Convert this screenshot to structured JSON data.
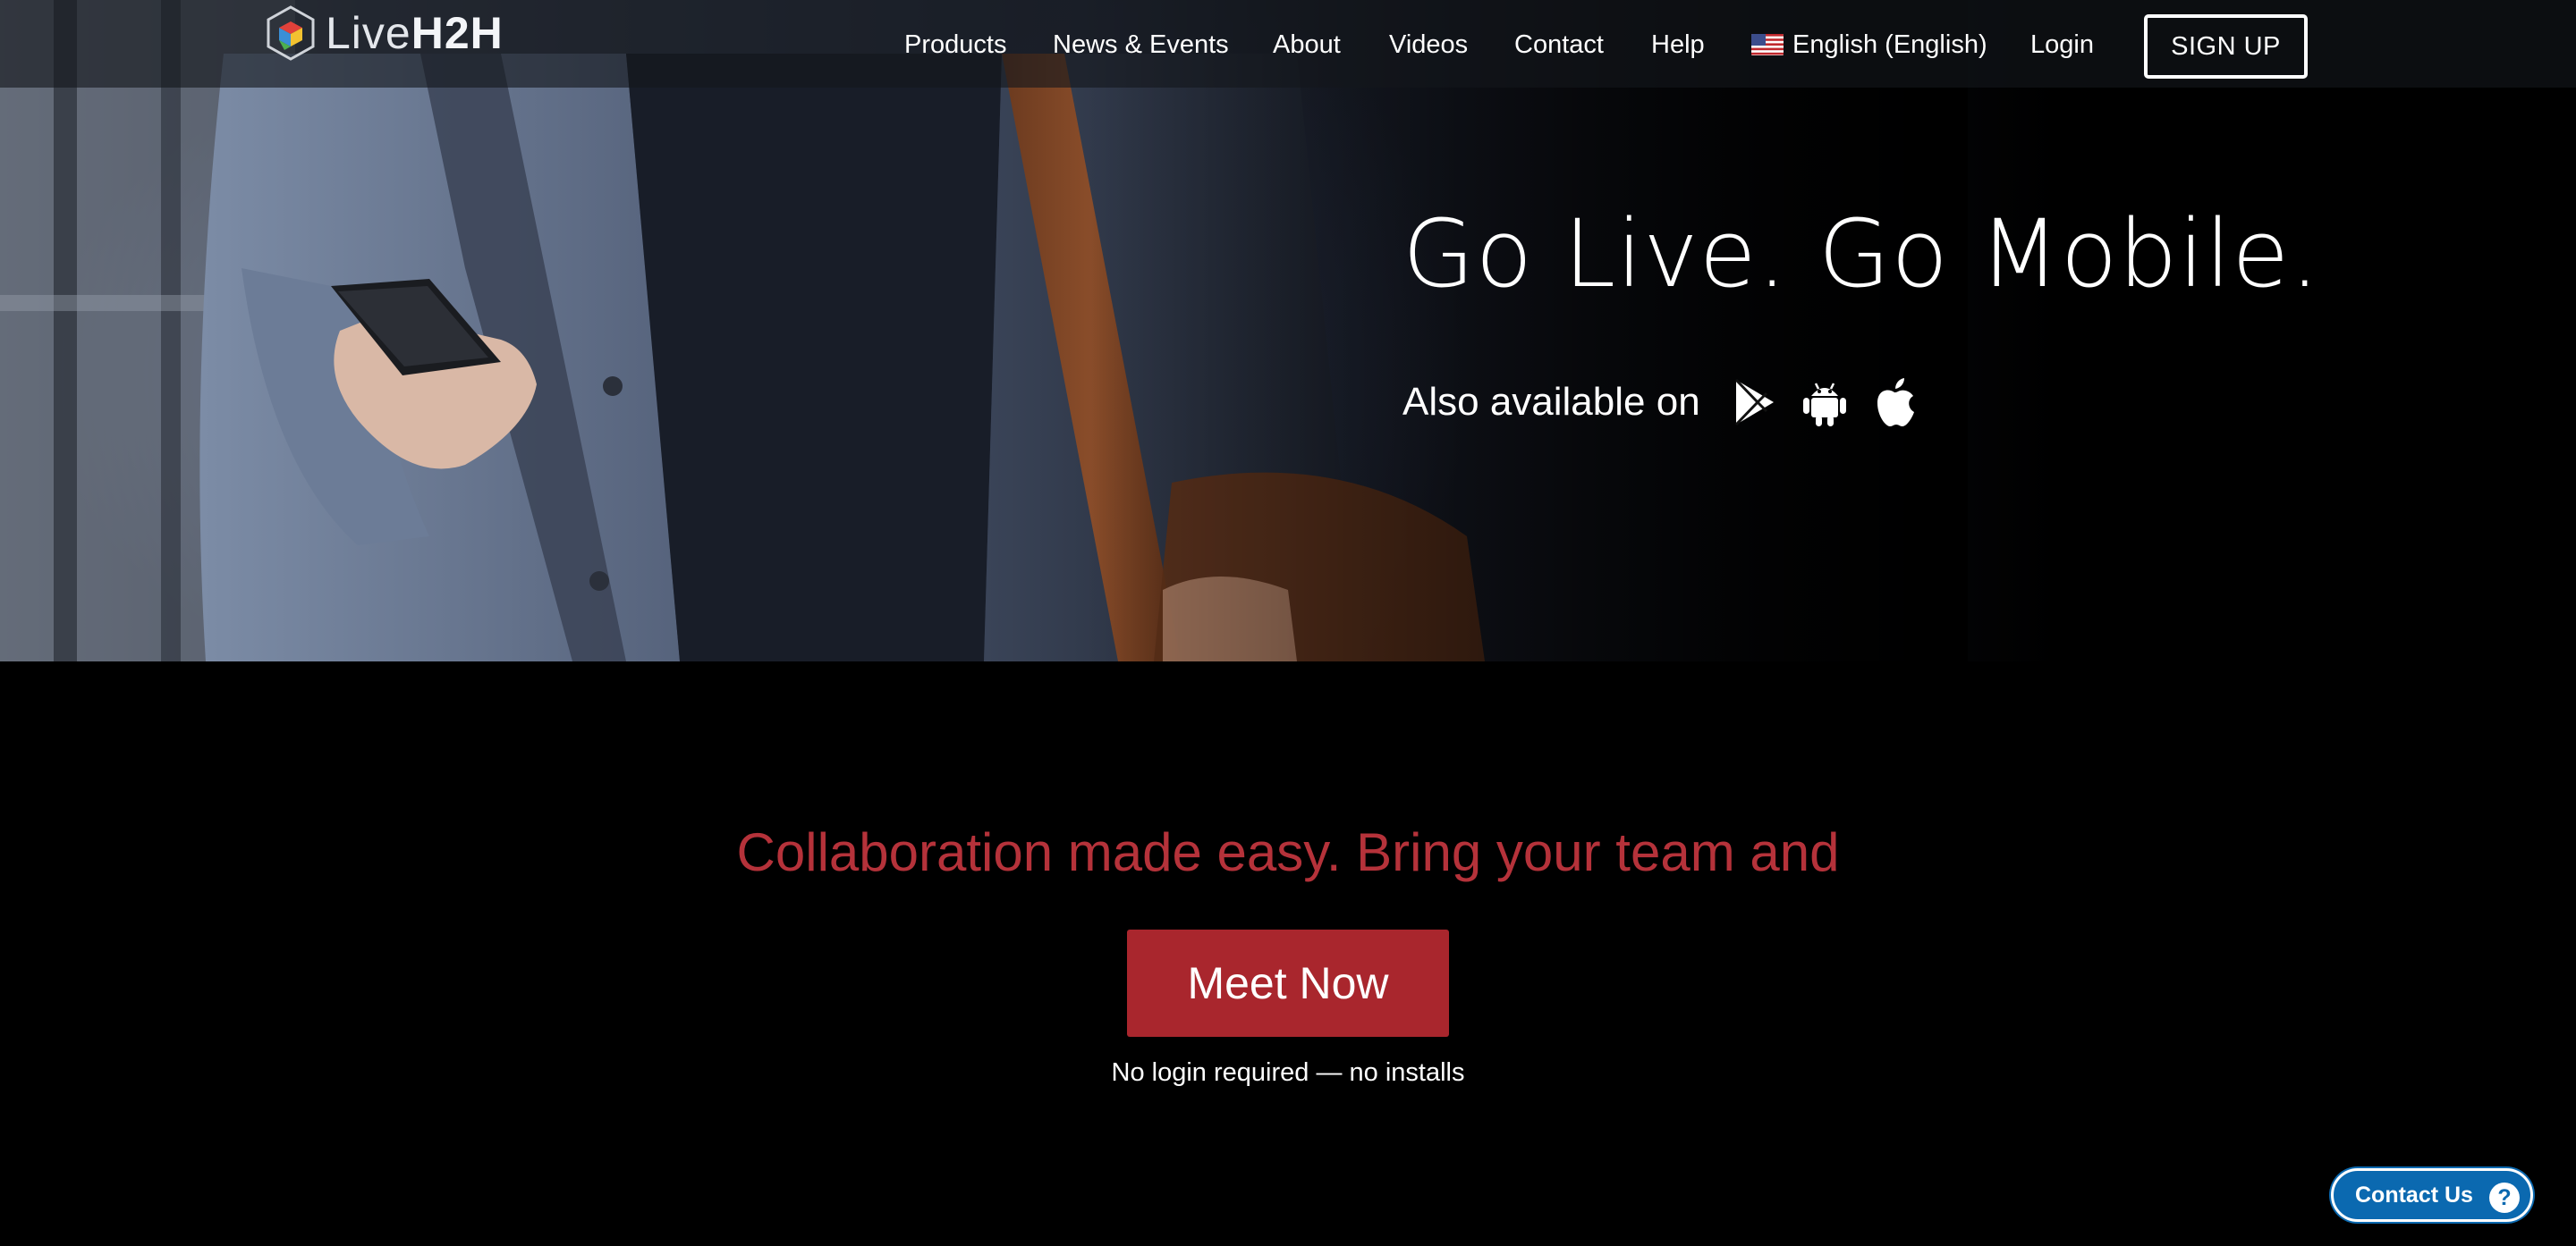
{
  "brand": {
    "logo_light": "Live",
    "logo_bold": "H2H"
  },
  "nav": {
    "items": [
      {
        "label": "Products"
      },
      {
        "label": "News & Events"
      },
      {
        "label": "About"
      },
      {
        "label": "Videos"
      },
      {
        "label": "Contact"
      },
      {
        "label": "Help"
      }
    ],
    "language": "English (English)",
    "language_flag": "us-flag-icon",
    "login": "Login",
    "signup": "SIGN UP"
  },
  "hero": {
    "title": "Go Live. Go Mobile.",
    "also_available": "Also available on",
    "store_icons": [
      "google-play-icon",
      "android-icon",
      "apple-icon"
    ]
  },
  "main": {
    "tagline": "Collaboration made easy. Bring your team and",
    "cta": "Meet Now",
    "subtext": "No login required — no installs"
  },
  "widget": {
    "contact_label": "Contact Us",
    "help_glyph": "?"
  },
  "colors": {
    "accent_red": "#a9262d",
    "tagline_red": "#b5323a",
    "contact_blue": "#0b69b0",
    "background": "#000000"
  }
}
